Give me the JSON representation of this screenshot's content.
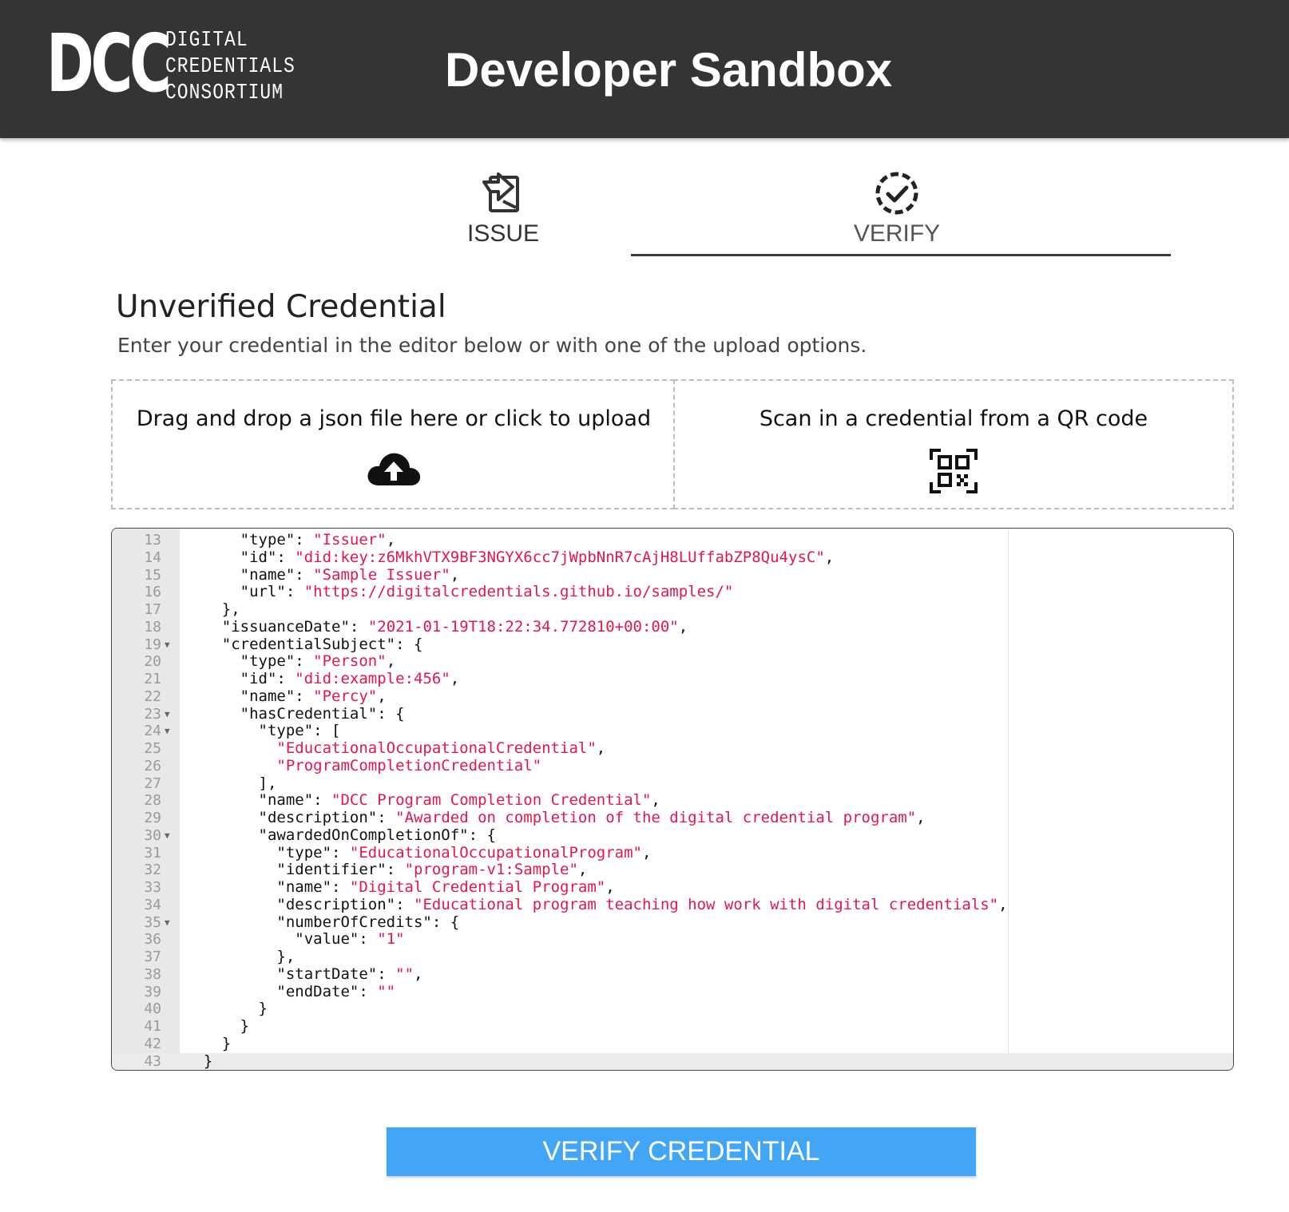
{
  "header": {
    "logo_mark": "DCC",
    "logo_lines": [
      "DIGITAL",
      "CREDENTIALS",
      "CONSORTIUM"
    ],
    "title": "Developer Sandbox"
  },
  "tabs": [
    {
      "label": "ISSUE",
      "icon": "issue-icon",
      "active": false
    },
    {
      "label": "VERIFY",
      "icon": "verify-badge-icon",
      "active": true
    }
  ],
  "section": {
    "title": "Unverified Credential",
    "description": "Enter your credential in the editor below or with one of the upload options."
  },
  "upload": {
    "drop_label": "Drag and drop a json file here or click to upload",
    "drop_icon": "cloud-upload-icon",
    "qr_label": "Scan in a credential from a QR code",
    "qr_icon": "qr-code-icon"
  },
  "editor": {
    "lines": [
      {
        "n": "13",
        "fold": false,
        "segs": [
          [
            "      ",
            "k"
          ],
          [
            "\"type\"",
            "k"
          ],
          [
            ": ",
            "k"
          ],
          [
            "\"Issuer\"",
            "s"
          ],
          [
            ",",
            "k"
          ]
        ]
      },
      {
        "n": "14",
        "fold": false,
        "segs": [
          [
            "      ",
            "k"
          ],
          [
            "\"id\"",
            "k"
          ],
          [
            ": ",
            "k"
          ],
          [
            "\"did:key:z6MkhVTX9BF3NGYX6cc7jWpbNnR7cAjH8LUffabZP8Qu4ysC\"",
            "s"
          ],
          [
            ",",
            "k"
          ]
        ]
      },
      {
        "n": "15",
        "fold": false,
        "segs": [
          [
            "      ",
            "k"
          ],
          [
            "\"name\"",
            "k"
          ],
          [
            ": ",
            "k"
          ],
          [
            "\"Sample Issuer\"",
            "s"
          ],
          [
            ",",
            "k"
          ]
        ]
      },
      {
        "n": "16",
        "fold": false,
        "segs": [
          [
            "      ",
            "k"
          ],
          [
            "\"url\"",
            "k"
          ],
          [
            ": ",
            "k"
          ],
          [
            "\"https://digitalcredentials.github.io/samples/\"",
            "s"
          ]
        ]
      },
      {
        "n": "17",
        "fold": false,
        "segs": [
          [
            "    },",
            "k"
          ]
        ]
      },
      {
        "n": "18",
        "fold": false,
        "segs": [
          [
            "    ",
            "k"
          ],
          [
            "\"issuanceDate\"",
            "k"
          ],
          [
            ": ",
            "k"
          ],
          [
            "\"2021-01-19T18:22:34.772810+00:00\"",
            "s"
          ],
          [
            ",",
            "k"
          ]
        ]
      },
      {
        "n": "19",
        "fold": true,
        "segs": [
          [
            "    ",
            "k"
          ],
          [
            "\"credentialSubject\"",
            "k"
          ],
          [
            ": {",
            "k"
          ]
        ]
      },
      {
        "n": "20",
        "fold": false,
        "segs": [
          [
            "      ",
            "k"
          ],
          [
            "\"type\"",
            "k"
          ],
          [
            ": ",
            "k"
          ],
          [
            "\"Person\"",
            "s"
          ],
          [
            ",",
            "k"
          ]
        ]
      },
      {
        "n": "21",
        "fold": false,
        "segs": [
          [
            "      ",
            "k"
          ],
          [
            "\"id\"",
            "k"
          ],
          [
            ": ",
            "k"
          ],
          [
            "\"did:example:456\"",
            "s"
          ],
          [
            ",",
            "k"
          ]
        ]
      },
      {
        "n": "22",
        "fold": false,
        "segs": [
          [
            "      ",
            "k"
          ],
          [
            "\"name\"",
            "k"
          ],
          [
            ": ",
            "k"
          ],
          [
            "\"Percy\"",
            "s"
          ],
          [
            ",",
            "k"
          ]
        ]
      },
      {
        "n": "23",
        "fold": true,
        "segs": [
          [
            "      ",
            "k"
          ],
          [
            "\"hasCredential\"",
            "k"
          ],
          [
            ": {",
            "k"
          ]
        ]
      },
      {
        "n": "24",
        "fold": true,
        "segs": [
          [
            "        ",
            "k"
          ],
          [
            "\"type\"",
            "k"
          ],
          [
            ": [",
            "k"
          ]
        ]
      },
      {
        "n": "25",
        "fold": false,
        "segs": [
          [
            "          ",
            "k"
          ],
          [
            "\"EducationalOccupationalCredential\"",
            "s"
          ],
          [
            ",",
            "k"
          ]
        ]
      },
      {
        "n": "26",
        "fold": false,
        "segs": [
          [
            "          ",
            "k"
          ],
          [
            "\"ProgramCompletionCredential\"",
            "s"
          ]
        ]
      },
      {
        "n": "27",
        "fold": false,
        "segs": [
          [
            "        ],",
            "k"
          ]
        ]
      },
      {
        "n": "28",
        "fold": false,
        "segs": [
          [
            "        ",
            "k"
          ],
          [
            "\"name\"",
            "k"
          ],
          [
            ": ",
            "k"
          ],
          [
            "\"DCC Program Completion Credential\"",
            "s"
          ],
          [
            ",",
            "k"
          ]
        ]
      },
      {
        "n": "29",
        "fold": false,
        "segs": [
          [
            "        ",
            "k"
          ],
          [
            "\"description\"",
            "k"
          ],
          [
            ": ",
            "k"
          ],
          [
            "\"Awarded on completion of the digital credential program\"",
            "s"
          ],
          [
            ",",
            "k"
          ]
        ]
      },
      {
        "n": "30",
        "fold": true,
        "segs": [
          [
            "        ",
            "k"
          ],
          [
            "\"awardedOnCompletionOf\"",
            "k"
          ],
          [
            ": {",
            "k"
          ]
        ]
      },
      {
        "n": "31",
        "fold": false,
        "segs": [
          [
            "          ",
            "k"
          ],
          [
            "\"type\"",
            "k"
          ],
          [
            ": ",
            "k"
          ],
          [
            "\"EducationalOccupationalProgram\"",
            "s"
          ],
          [
            ",",
            "k"
          ]
        ]
      },
      {
        "n": "32",
        "fold": false,
        "segs": [
          [
            "          ",
            "k"
          ],
          [
            "\"identifier\"",
            "k"
          ],
          [
            ": ",
            "k"
          ],
          [
            "\"program-v1:Sample\"",
            "s"
          ],
          [
            ",",
            "k"
          ]
        ]
      },
      {
        "n": "33",
        "fold": false,
        "segs": [
          [
            "          ",
            "k"
          ],
          [
            "\"name\"",
            "k"
          ],
          [
            ": ",
            "k"
          ],
          [
            "\"Digital Credential Program\"",
            "s"
          ],
          [
            ",",
            "k"
          ]
        ]
      },
      {
        "n": "34",
        "fold": false,
        "segs": [
          [
            "          ",
            "k"
          ],
          [
            "\"description\"",
            "k"
          ],
          [
            ": ",
            "k"
          ],
          [
            "\"Educational program teaching how work with digital credentials\"",
            "s"
          ],
          [
            ",",
            "k"
          ]
        ]
      },
      {
        "n": "35",
        "fold": true,
        "segs": [
          [
            "          ",
            "k"
          ],
          [
            "\"numberOfCredits\"",
            "k"
          ],
          [
            ": {",
            "k"
          ]
        ]
      },
      {
        "n": "36",
        "fold": false,
        "segs": [
          [
            "            ",
            "k"
          ],
          [
            "\"value\"",
            "k"
          ],
          [
            ": ",
            "k"
          ],
          [
            "\"1\"",
            "s"
          ]
        ]
      },
      {
        "n": "37",
        "fold": false,
        "segs": [
          [
            "          },",
            "k"
          ]
        ]
      },
      {
        "n": "38",
        "fold": false,
        "segs": [
          [
            "          ",
            "k"
          ],
          [
            "\"startDate\"",
            "k"
          ],
          [
            ": ",
            "k"
          ],
          [
            "\"\"",
            "s"
          ],
          [
            ",",
            "k"
          ]
        ]
      },
      {
        "n": "39",
        "fold": false,
        "segs": [
          [
            "          ",
            "k"
          ],
          [
            "\"endDate\"",
            "k"
          ],
          [
            ": ",
            "k"
          ],
          [
            "\"\"",
            "s"
          ]
        ]
      },
      {
        "n": "40",
        "fold": false,
        "segs": [
          [
            "        }",
            "k"
          ]
        ]
      },
      {
        "n": "41",
        "fold": false,
        "segs": [
          [
            "      }",
            "k"
          ]
        ]
      },
      {
        "n": "42",
        "fold": false,
        "segs": [
          [
            "    }",
            "k"
          ]
        ]
      },
      {
        "n": "43",
        "fold": false,
        "active": true,
        "segs": [
          [
            "  }",
            "k"
          ]
        ]
      }
    ]
  },
  "actions": {
    "verify_label": "VERIFY CREDENTIAL"
  },
  "colors": {
    "header_bg": "#343434",
    "string": "#e3174d",
    "button": "#42a5f5"
  }
}
